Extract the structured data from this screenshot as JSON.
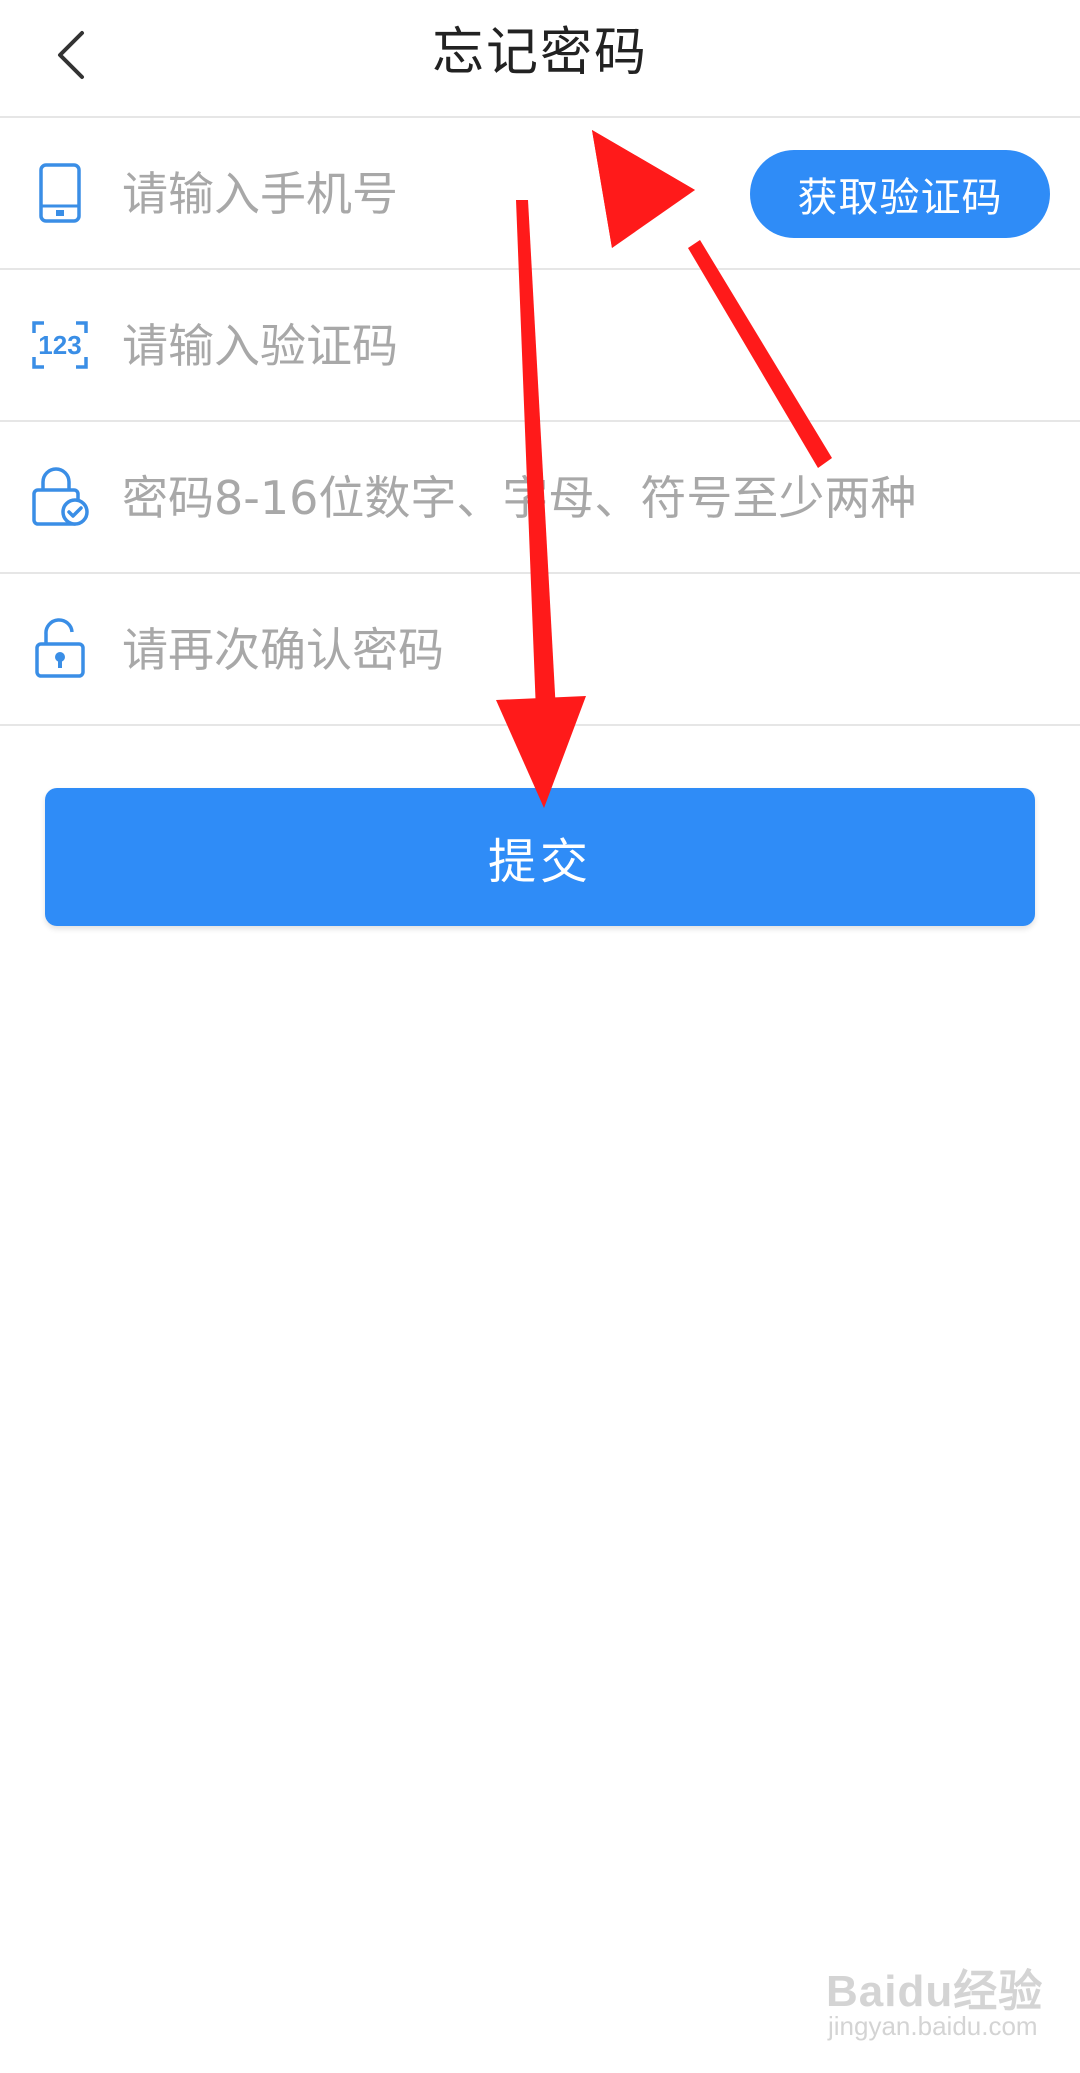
{
  "header": {
    "title": "忘记密码",
    "back_icon": "chevron-left-icon"
  },
  "form": {
    "phone": {
      "placeholder": "请输入手机号",
      "icon": "phone-icon",
      "get_code_label": "获取验证码"
    },
    "code": {
      "placeholder": "请输入验证码",
      "icon": "number-123-icon",
      "icon_text": "123"
    },
    "password": {
      "placeholder": "密码8-16位数字、字母、符号至少两种",
      "icon": "lock-check-icon"
    },
    "confirm": {
      "placeholder": "请再次确认密码",
      "icon": "unlock-icon"
    },
    "submit_label": "提交"
  },
  "watermark": {
    "brand": "Baidu经验",
    "site": "jingyan.baidu.com"
  },
  "colors": {
    "accent": "#2f8cf7",
    "icon_blue": "#3a8ee6",
    "arrow_red": "#ff1a1a",
    "placeholder": "#a8a8a8"
  }
}
